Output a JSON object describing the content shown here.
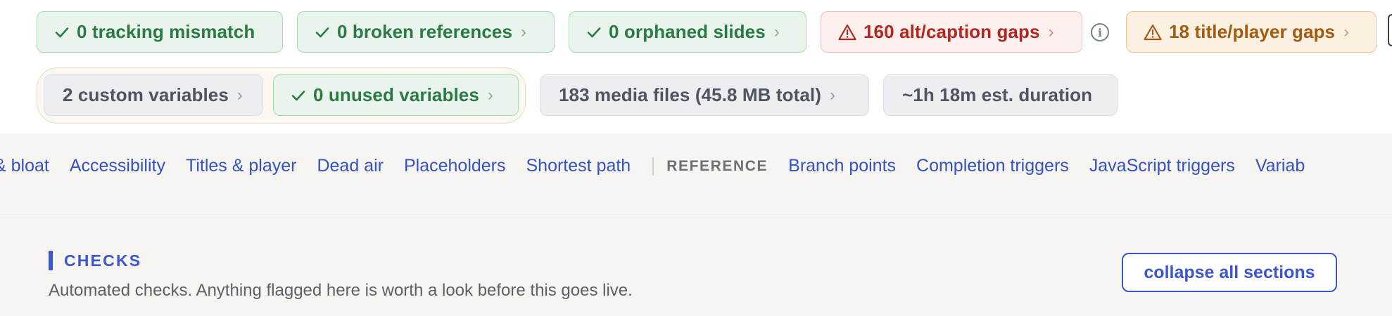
{
  "summary": {
    "tracking": {
      "icon": "check-icon",
      "label": "0 tracking mismatch"
    },
    "broken_refs": {
      "icon": "check-icon",
      "label": "0 broken references"
    },
    "orphaned": {
      "icon": "check-icon",
      "label": "0 orphaned slides"
    },
    "alt_caption": {
      "icon": "warning-icon",
      "label": "160 alt/caption gaps"
    },
    "title_player": {
      "icon": "warning-icon",
      "label": "18 title/player gaps"
    },
    "custom_vars": {
      "label": "2 custom variables"
    },
    "unused_vars": {
      "icon": "check-icon",
      "label": "0 unused variables"
    },
    "media": {
      "label": "183 media files (45.8 MB total)"
    },
    "duration": {
      "label": "~1h 18m est. duration"
    },
    "info_icon": "info-icon",
    "chevron_icon": "chevron-right-icon"
  },
  "nav": {
    "links": [
      "& bloat",
      "Accessibility",
      "Titles & player",
      "Dead air",
      "Placeholders",
      "Shortest path"
    ],
    "reference_label": "REFERENCE",
    "reference_links": [
      "Branch points",
      "Completion triggers",
      "JavaScript triggers",
      "Variab"
    ]
  },
  "section": {
    "title": "CHECKS",
    "description": "Automated checks. Anything flagged here is worth a look before this goes live.",
    "collapse_label": "collapse all sections"
  },
  "colors": {
    "ok": "#2b7a43",
    "error": "#b3261e",
    "warning": "#a15c12",
    "neutral": "#4e5560",
    "accent": "#3b56cf"
  }
}
